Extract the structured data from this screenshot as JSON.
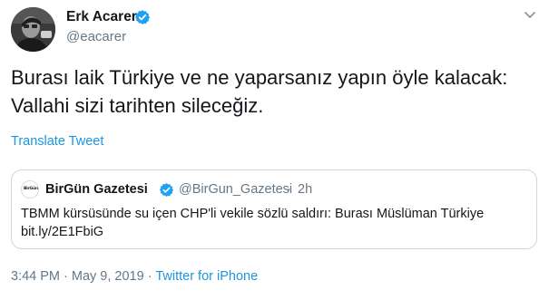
{
  "author": {
    "name": "Erk Acarer",
    "handle": "@eacarer",
    "verified": true
  },
  "tweet": {
    "lines": [
      "Burası laik Türkiye ve ne yaparsanız yapın öyle kalacak:",
      "Vallahi sizi tarihten sileceğiz."
    ],
    "translate_label": "Translate Tweet"
  },
  "quoted_tweet": {
    "name": "BirGün Gazetesi",
    "avatar_text": "BirGün",
    "verified": true,
    "handle": "@BirGun_Gazetesi",
    "separator": "·",
    "time": "2h",
    "lines": [
      "TBMM kürsüsünde su içen CHP'li vekile sözlü saldırı: Burası Müslüman Türkiye",
      "bit.ly/2E1FbiG"
    ]
  },
  "meta": {
    "time": "3:44 PM",
    "separator1": " · ",
    "date": "May 9, 2019",
    "separator2": " · ",
    "source": "Twitter for iPhone"
  },
  "colors": {
    "link": "#1b95e0",
    "verified": "#1da1f2",
    "secondary_text": "#657786",
    "border": "#ccd6dd"
  },
  "icons": {
    "verified": "verified-badge-icon",
    "caret": "chevron-down-icon"
  }
}
